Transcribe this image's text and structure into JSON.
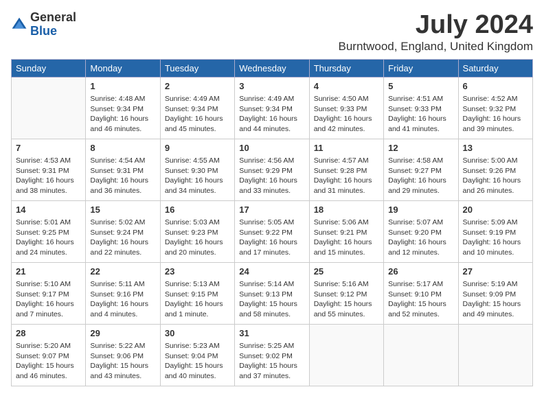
{
  "logo": {
    "general": "General",
    "blue": "Blue"
  },
  "title": "July 2024",
  "location": "Burntwood, England, United Kingdom",
  "days_of_week": [
    "Sunday",
    "Monday",
    "Tuesday",
    "Wednesday",
    "Thursday",
    "Friday",
    "Saturday"
  ],
  "weeks": [
    [
      {
        "num": "",
        "detail": ""
      },
      {
        "num": "1",
        "detail": "Sunrise: 4:48 AM\nSunset: 9:34 PM\nDaylight: 16 hours\nand 46 minutes."
      },
      {
        "num": "2",
        "detail": "Sunrise: 4:49 AM\nSunset: 9:34 PM\nDaylight: 16 hours\nand 45 minutes."
      },
      {
        "num": "3",
        "detail": "Sunrise: 4:49 AM\nSunset: 9:34 PM\nDaylight: 16 hours\nand 44 minutes."
      },
      {
        "num": "4",
        "detail": "Sunrise: 4:50 AM\nSunset: 9:33 PM\nDaylight: 16 hours\nand 42 minutes."
      },
      {
        "num": "5",
        "detail": "Sunrise: 4:51 AM\nSunset: 9:33 PM\nDaylight: 16 hours\nand 41 minutes."
      },
      {
        "num": "6",
        "detail": "Sunrise: 4:52 AM\nSunset: 9:32 PM\nDaylight: 16 hours\nand 39 minutes."
      }
    ],
    [
      {
        "num": "7",
        "detail": "Sunrise: 4:53 AM\nSunset: 9:31 PM\nDaylight: 16 hours\nand 38 minutes."
      },
      {
        "num": "8",
        "detail": "Sunrise: 4:54 AM\nSunset: 9:31 PM\nDaylight: 16 hours\nand 36 minutes."
      },
      {
        "num": "9",
        "detail": "Sunrise: 4:55 AM\nSunset: 9:30 PM\nDaylight: 16 hours\nand 34 minutes."
      },
      {
        "num": "10",
        "detail": "Sunrise: 4:56 AM\nSunset: 9:29 PM\nDaylight: 16 hours\nand 33 minutes."
      },
      {
        "num": "11",
        "detail": "Sunrise: 4:57 AM\nSunset: 9:28 PM\nDaylight: 16 hours\nand 31 minutes."
      },
      {
        "num": "12",
        "detail": "Sunrise: 4:58 AM\nSunset: 9:27 PM\nDaylight: 16 hours\nand 29 minutes."
      },
      {
        "num": "13",
        "detail": "Sunrise: 5:00 AM\nSunset: 9:26 PM\nDaylight: 16 hours\nand 26 minutes."
      }
    ],
    [
      {
        "num": "14",
        "detail": "Sunrise: 5:01 AM\nSunset: 9:25 PM\nDaylight: 16 hours\nand 24 minutes."
      },
      {
        "num": "15",
        "detail": "Sunrise: 5:02 AM\nSunset: 9:24 PM\nDaylight: 16 hours\nand 22 minutes."
      },
      {
        "num": "16",
        "detail": "Sunrise: 5:03 AM\nSunset: 9:23 PM\nDaylight: 16 hours\nand 20 minutes."
      },
      {
        "num": "17",
        "detail": "Sunrise: 5:05 AM\nSunset: 9:22 PM\nDaylight: 16 hours\nand 17 minutes."
      },
      {
        "num": "18",
        "detail": "Sunrise: 5:06 AM\nSunset: 9:21 PM\nDaylight: 16 hours\nand 15 minutes."
      },
      {
        "num": "19",
        "detail": "Sunrise: 5:07 AM\nSunset: 9:20 PM\nDaylight: 16 hours\nand 12 minutes."
      },
      {
        "num": "20",
        "detail": "Sunrise: 5:09 AM\nSunset: 9:19 PM\nDaylight: 16 hours\nand 10 minutes."
      }
    ],
    [
      {
        "num": "21",
        "detail": "Sunrise: 5:10 AM\nSunset: 9:17 PM\nDaylight: 16 hours\nand 7 minutes."
      },
      {
        "num": "22",
        "detail": "Sunrise: 5:11 AM\nSunset: 9:16 PM\nDaylight: 16 hours\nand 4 minutes."
      },
      {
        "num": "23",
        "detail": "Sunrise: 5:13 AM\nSunset: 9:15 PM\nDaylight: 16 hours\nand 1 minute."
      },
      {
        "num": "24",
        "detail": "Sunrise: 5:14 AM\nSunset: 9:13 PM\nDaylight: 15 hours\nand 58 minutes."
      },
      {
        "num": "25",
        "detail": "Sunrise: 5:16 AM\nSunset: 9:12 PM\nDaylight: 15 hours\nand 55 minutes."
      },
      {
        "num": "26",
        "detail": "Sunrise: 5:17 AM\nSunset: 9:10 PM\nDaylight: 15 hours\nand 52 minutes."
      },
      {
        "num": "27",
        "detail": "Sunrise: 5:19 AM\nSunset: 9:09 PM\nDaylight: 15 hours\nand 49 minutes."
      }
    ],
    [
      {
        "num": "28",
        "detail": "Sunrise: 5:20 AM\nSunset: 9:07 PM\nDaylight: 15 hours\nand 46 minutes."
      },
      {
        "num": "29",
        "detail": "Sunrise: 5:22 AM\nSunset: 9:06 PM\nDaylight: 15 hours\nand 43 minutes."
      },
      {
        "num": "30",
        "detail": "Sunrise: 5:23 AM\nSunset: 9:04 PM\nDaylight: 15 hours\nand 40 minutes."
      },
      {
        "num": "31",
        "detail": "Sunrise: 5:25 AM\nSunset: 9:02 PM\nDaylight: 15 hours\nand 37 minutes."
      },
      {
        "num": "",
        "detail": ""
      },
      {
        "num": "",
        "detail": ""
      },
      {
        "num": "",
        "detail": ""
      }
    ]
  ]
}
